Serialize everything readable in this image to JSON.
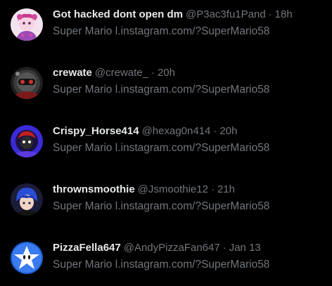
{
  "results": [
    {
      "display_name": "Got hacked dont open dm",
      "handle": "@P3ac3fu1Pand",
      "separator": "·",
      "time": "18h",
      "text_prefix": "Super Mario",
      "link": "l.instagram.com/?SuperMario58",
      "avatar_icon": "pink-character-avatar",
      "avatar_colors": {
        "bg": "#f3e3ef",
        "accent": "#c63a8f"
      }
    },
    {
      "display_name": "crewate",
      "handle": "@crewate_",
      "separator": "·",
      "time": "20h",
      "text_prefix": "Super Mario",
      "link": "l.instagram.com/?SuperMario58",
      "avatar_icon": "dark-robot-avatar",
      "avatar_colors": {
        "bg": "#2a2a2a",
        "accent": "#b52a2a"
      }
    },
    {
      "display_name": "Crispy_Horse414",
      "handle": "@hexag0n414",
      "separator": "·",
      "time": "20h",
      "text_prefix": "Super Mario",
      "link": "l.instagram.com/?SuperMario58",
      "avatar_icon": "purple-character-avatar",
      "avatar_colors": {
        "bg": "#3a2bd6",
        "accent": "#c21f1f"
      }
    },
    {
      "display_name": "thrownsmoothie",
      "handle": "@Jsmoothie12",
      "separator": "·",
      "time": "21h",
      "text_prefix": "Super Mario",
      "link": "l.instagram.com/?SuperMario58",
      "avatar_icon": "blue-hair-character-avatar",
      "avatar_colors": {
        "bg": "#1c1c3a",
        "accent": "#2a4fd6"
      }
    },
    {
      "display_name": "PizzaFella647",
      "handle": "@AndyPizzaFan647",
      "separator": "·",
      "time": "Jan 13",
      "text_prefix": "Super Mario",
      "link": "l.instagram.com/?SuperMario58",
      "avatar_icon": "white-star-avatar",
      "avatar_colors": {
        "bg": "#1c5fd4",
        "accent": "#ffffff"
      }
    }
  ]
}
